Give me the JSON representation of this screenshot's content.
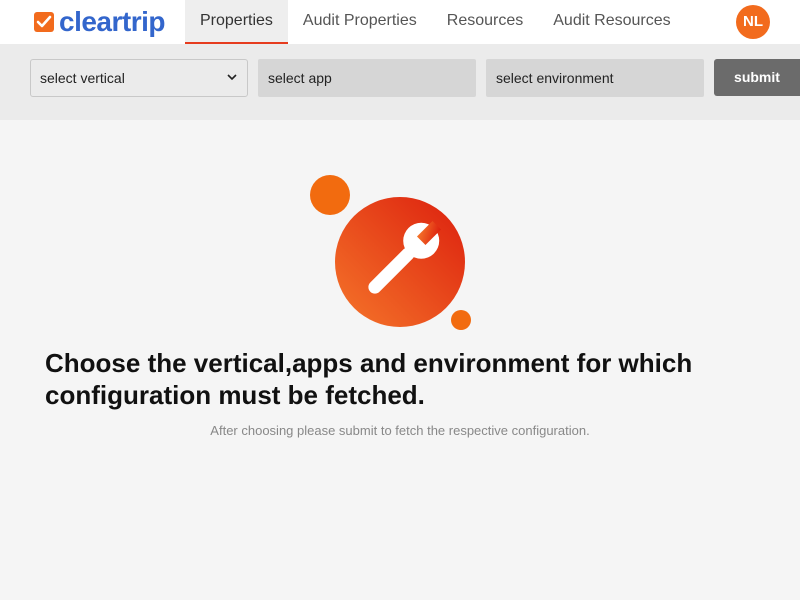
{
  "header": {
    "logo_text": "cleartrip",
    "tabs": [
      {
        "label": "Properties",
        "active": true
      },
      {
        "label": "Audit Properties",
        "active": false
      },
      {
        "label": "Resources",
        "active": false
      },
      {
        "label": "Audit Resources",
        "active": false
      }
    ],
    "avatar_initials": "NL"
  },
  "filters": {
    "vertical_select": {
      "value": "select vertical"
    },
    "app_field": {
      "value": "select app"
    },
    "environment_field": {
      "value": "select environment"
    },
    "submit_label": "submit"
  },
  "empty_state": {
    "icon": "wrench-icon",
    "headline": "Choose the vertical,apps and environment for which configuration must be fetched.",
    "subtext": "After choosing please submit to fetch the respective configuration."
  },
  "colors": {
    "brand_orange": "#f26b1d",
    "brand_blue": "#3366cc",
    "active_tab_underline": "#e63c1e",
    "submit_bg": "#6b6b6b"
  }
}
